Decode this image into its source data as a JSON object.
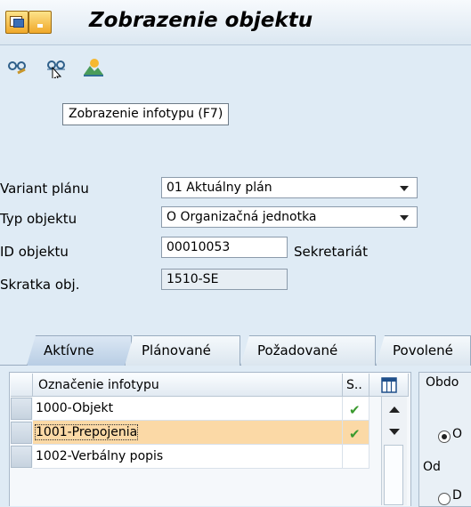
{
  "title_bar": {
    "title": "Zobrazenie objektu"
  },
  "tooltip": {
    "text": "Zobrazenie infotypu   (F7)"
  },
  "form": {
    "variant_label": "Variant plánu",
    "variant_value": "01 Aktuálny plán",
    "type_label": "Typ objektu",
    "type_value": "O Organizačná jednotka",
    "id_label": "ID objektu",
    "id_value": "00010053",
    "id_text": "Sekretariát",
    "abbr_label": "Skratka obj.",
    "abbr_value": "1510-SE"
  },
  "tabs": [
    "Aktívne",
    "Plánované",
    "Požadované",
    "Povolené"
  ],
  "table": {
    "col_name": "Označenie infotypu",
    "col_status": "S..",
    "rows": [
      {
        "name": "1000-Objekt",
        "status": "✔"
      },
      {
        "name": "1001-Prepojenia",
        "status": "✔"
      },
      {
        "name": "1002-Verbálny popis",
        "status": ""
      }
    ]
  },
  "period": {
    "title": "Obdo",
    "radio1_label": "O",
    "od_label": "Od",
    "radio2_label": "D"
  },
  "colors": {
    "background": "#dfebf5",
    "selected_row": "#fbd9a6",
    "check": "#3a9a2e"
  }
}
